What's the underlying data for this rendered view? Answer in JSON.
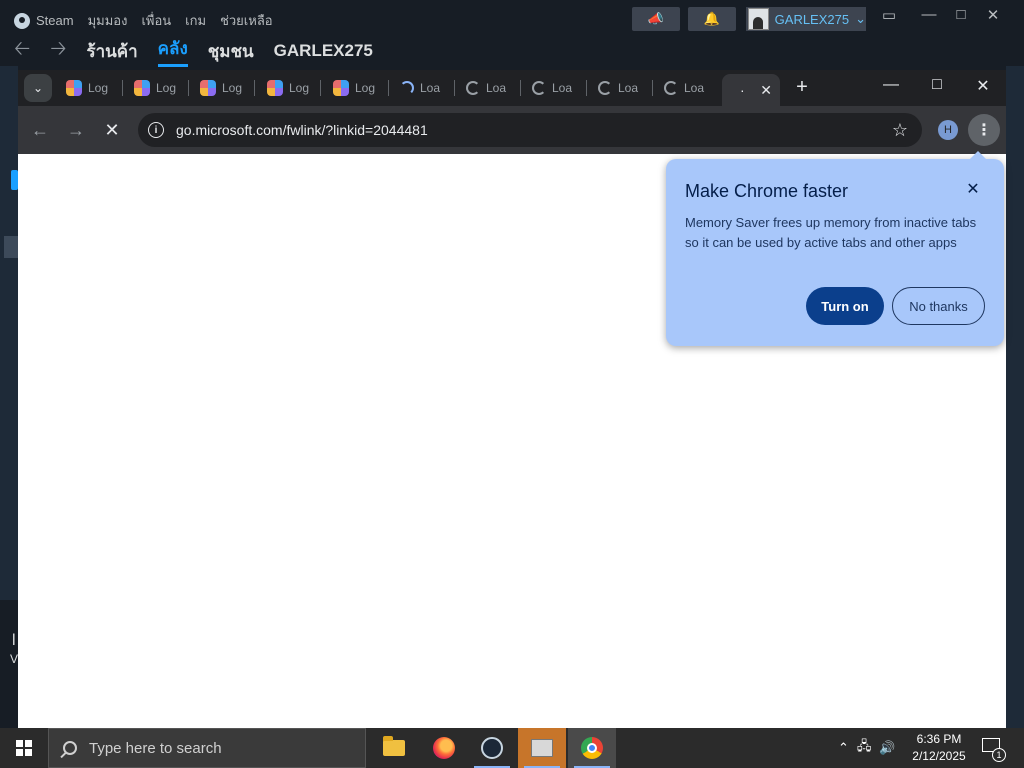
{
  "steam": {
    "menu": [
      "Steam",
      "มุมมอง",
      "เพื่อน",
      "เกม",
      "ช่วยเหลือ"
    ],
    "nav": [
      "ร้านค้า",
      "คลัง",
      "ชุมชน",
      "GARLEX275"
    ],
    "active_nav": "คลัง",
    "username": "GARLEX275",
    "bottom_char": "l",
    "bottom_char2": "V"
  },
  "chrome": {
    "tabs": [
      {
        "label": "Log",
        "icon": "copilot-icon"
      },
      {
        "label": "Log",
        "icon": "copilot-icon"
      },
      {
        "label": "Log",
        "icon": "copilot-icon"
      },
      {
        "label": "Log",
        "icon": "copilot-icon"
      },
      {
        "label": "Log",
        "icon": "copilot-icon"
      },
      {
        "label": "Loa",
        "icon": "loading-spinner-icon"
      },
      {
        "label": "Loa",
        "icon": "loading-spinner-icon"
      },
      {
        "label": "Loa",
        "icon": "loading-spinner-icon"
      },
      {
        "label": "Loa",
        "icon": "loading-spinner-icon"
      },
      {
        "label": "Loa",
        "icon": "loading-spinner-icon"
      }
    ],
    "url": "go.microsoft.com/fwlink/?linkid=2044481",
    "profile_initial": "H"
  },
  "memory_saver": {
    "title": "Make Chrome faster",
    "body": "Memory Saver frees up memory from inactive tabs so it can be used by active tabs and other apps",
    "turn_on": "Turn on",
    "no_thanks": "No thanks"
  },
  "taskbar": {
    "search_placeholder": "Type here to search",
    "time": "6:36 PM",
    "date": "2/12/2025",
    "notification_count": "1"
  }
}
